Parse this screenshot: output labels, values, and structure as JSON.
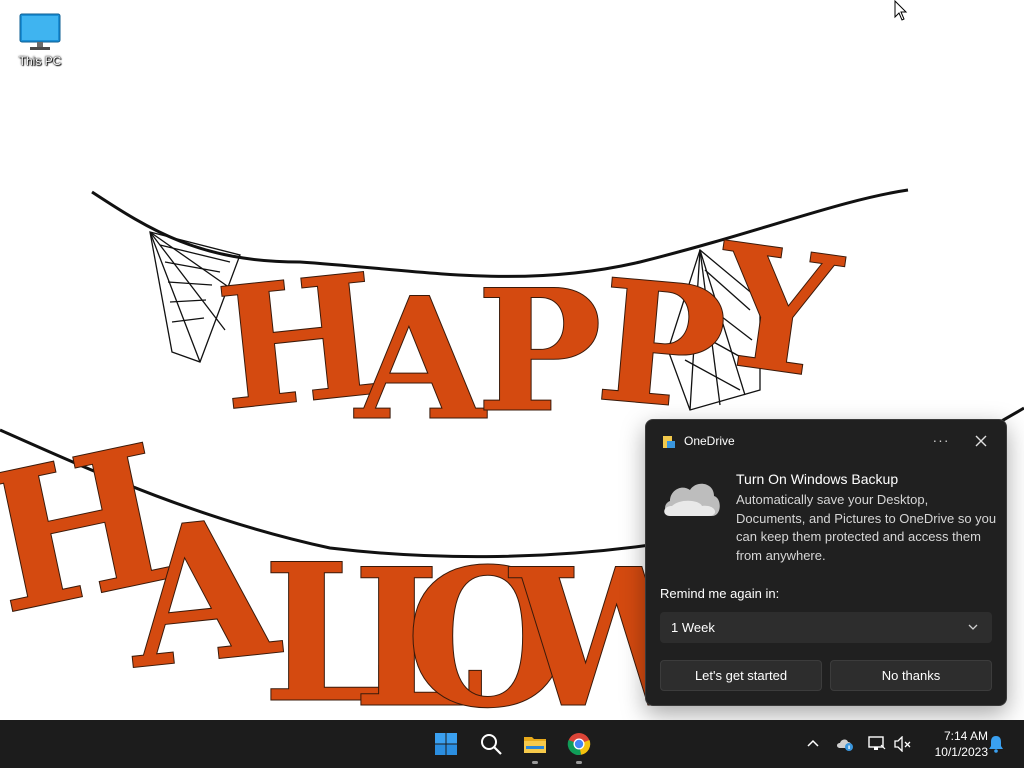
{
  "desktop": {
    "icons": [
      {
        "label": "This PC",
        "icon": "monitor-icon"
      }
    ],
    "wallpaper": {
      "line1": "HAPPY",
      "line2": "HALLOW",
      "letter_color": "#d44a10"
    }
  },
  "toast": {
    "app_name": "OneDrive",
    "more_label": "···",
    "title": "Turn On Windows Backup",
    "body": "Automatically save your Desktop, Documents, and Pictures to OneDrive so you can keep them protected and access them from anywhere.",
    "remind_label": "Remind me again in:",
    "remind_value": "1 Week",
    "primary_button": "Let's get started",
    "secondary_button": "No thanks",
    "colors": {
      "background": "#202020",
      "button": "#2d2d2d"
    }
  },
  "taskbar": {
    "apps": [
      {
        "name": "Start",
        "icon": "windows-start-icon"
      },
      {
        "name": "Search",
        "icon": "search-icon"
      },
      {
        "name": "File Explorer",
        "icon": "folder-icon"
      },
      {
        "name": "Google Chrome",
        "icon": "chrome-icon"
      }
    ],
    "tray": {
      "icons": [
        "chevron-up-icon",
        "onedrive-icon",
        "network-icon",
        "volume-muted-icon",
        "notification-bell-icon"
      ]
    },
    "clock": {
      "time": "7:14 AM",
      "date": "10/1/2023"
    }
  }
}
